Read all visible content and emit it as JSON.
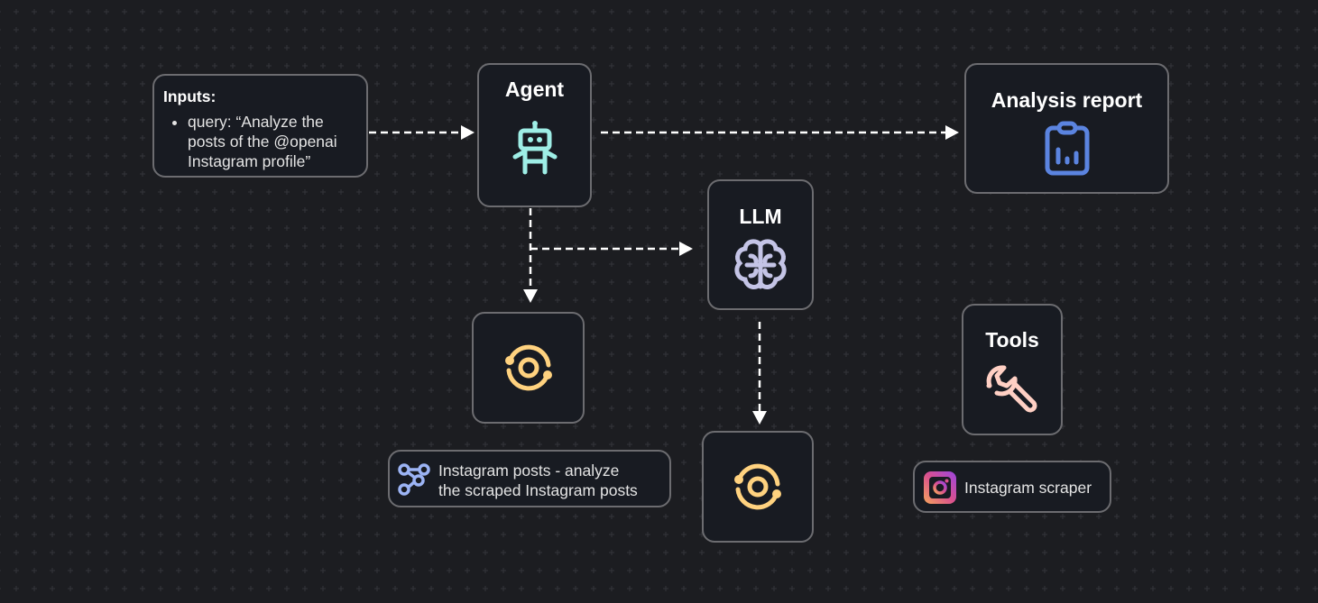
{
  "inputs": {
    "heading": "Inputs:",
    "items": [
      "query: “Analyze the posts of the @openai Instagram profile”"
    ]
  },
  "agent": {
    "title": "Agent",
    "icon": "robot-icon",
    "color": "#9eeee6"
  },
  "analysis_report": {
    "title": "Analysis report",
    "icon": "clipboard-chart-icon",
    "color": "#5b84e0"
  },
  "llm": {
    "title": "LLM",
    "icon": "brain-icon",
    "color": "#c4c4e6"
  },
  "loop_nodes": [
    {
      "icon": "loop-icon",
      "color": "#ffd27f"
    },
    {
      "icon": "loop-icon",
      "color": "#ffd27f"
    }
  ],
  "task": {
    "icon": "share-nodes-icon",
    "color": "#9cb4f5",
    "label_line1": "Instagram posts - analyze",
    "label_line2": "the scraped Instagram posts"
  },
  "tools": {
    "title": "Tools",
    "icon": "wrench-icon",
    "color": "#ffd0c4"
  },
  "tool_item": {
    "icon": "instagram-icon",
    "label": "Instagram scraper"
  }
}
